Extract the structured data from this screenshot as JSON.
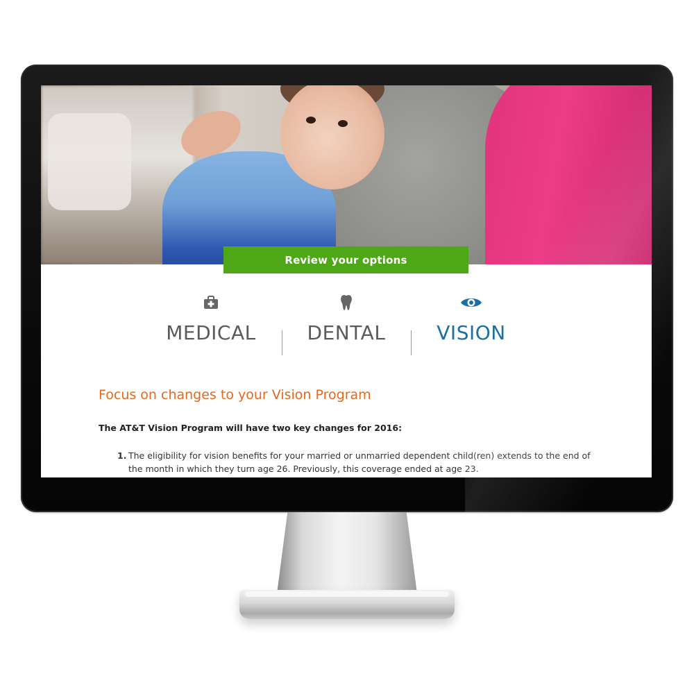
{
  "hero": {
    "cta_label": "Review your options"
  },
  "tabs": [
    {
      "label": "MEDICAL",
      "icon": "medical-kit-icon",
      "active": false
    },
    {
      "label": "DENTAL",
      "icon": "tooth-icon",
      "active": false
    },
    {
      "label": "VISION",
      "icon": "eye-icon",
      "active": true
    }
  ],
  "content": {
    "heading": "Focus on changes to your Vision Program",
    "intro": "The AT&T Vision Program will have two key changes for 2016:",
    "items": [
      {
        "number": "1.",
        "text": "The eligibility for vision benefits for your married or unmarried dependent child(ren) extends to the end of the month in which they turn age 26. Previously, this coverage ended at age 23."
      }
    ]
  },
  "colors": {
    "cta": "#4ea716",
    "active_tab": "#1b6fa4",
    "inactive_tab": "#5a5a5a",
    "heading": "#e5681c"
  }
}
